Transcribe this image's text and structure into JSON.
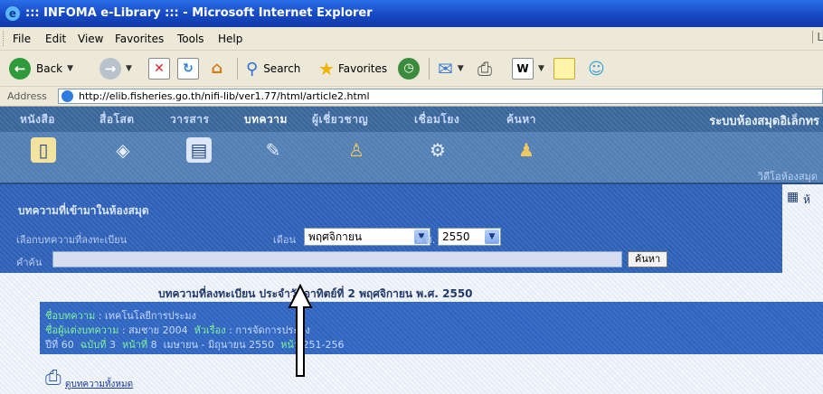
{
  "window": {
    "title": "::: INFOMA e-Library ::: - Microsoft Internet Explorer",
    "edge_letter": "L"
  },
  "menubar": {
    "items": [
      "File",
      "Edit",
      "View",
      "Favorites",
      "Tools",
      "Help"
    ]
  },
  "toolbar": {
    "back_label": "Back",
    "search_label": "Search",
    "favorites_label": "Favorites"
  },
  "address": {
    "label": "Address",
    "url": "http://elib.fisheries.go.th/nifi-lib/ver1.77/html/article2.html"
  },
  "site": {
    "tabs": [
      "หนังสือ",
      "สื่อโสต",
      "วารสาร",
      "บทความ",
      "ผู้เชี่ยวชาญ",
      "เชื่อมโยง",
      "ค้นหา"
    ],
    "active_tab": "บทความ",
    "system_title": "ระบบห้องสมุดอิเล็กทร",
    "strip_label": "วิดีโอห้องสมุด",
    "section_title": "บทความที่เข้ามาในห้องสมุด",
    "filter_label": "เลือกบทความที่ลงทะเบียน",
    "month_label": "เดือน",
    "month_value": "พฤศจิกายน",
    "year_label": "พ.ศ.",
    "year_value": "2550",
    "search_label": "คำค้น",
    "search_button": "ค้นหา",
    "side_text": "ห้"
  },
  "article": {
    "heading": "บทความที่ลงทะเบียน ประจำวันอาทิตย์ที่ 2 พฤศจิกายน พ.ศ. 2550",
    "line1_key": "ชื่อบทความ",
    "line1_value": "เทคโนโลยีการประมง",
    "line2_key": "ชื่อผู้แต่งบทความ",
    "line2_value": "สมชาย 2004",
    "line2_key2": "หัวเรื่อง",
    "line2_value2": "การจัดการประมง",
    "line3_prefix": "ปีที่",
    "line3_year": "60",
    "line3_issue_key": "ฉบับที่",
    "line3_issue": "3",
    "line3_page_key": "หน้าที่",
    "line3_page": "8",
    "line3_rest": "เมษายน - มิถุนายน 2550",
    "line3_pages_key": "หน้า",
    "line3_pages": "251-256"
  },
  "back_link": "ดูบทความทั้งหมด",
  "colors": {
    "title_blue": "#1748c4",
    "panel_blue": "#2e5fb3",
    "chrome": "#ece9d8"
  },
  "icons": [
    "ie-logo",
    "back-icon",
    "forward-icon",
    "stop-icon",
    "refresh-icon",
    "home-icon",
    "search-icon",
    "favorites-star-icon",
    "history-icon",
    "mail-icon",
    "print-icon",
    "edit-icon",
    "folder-icon",
    "messenger-icon"
  ]
}
